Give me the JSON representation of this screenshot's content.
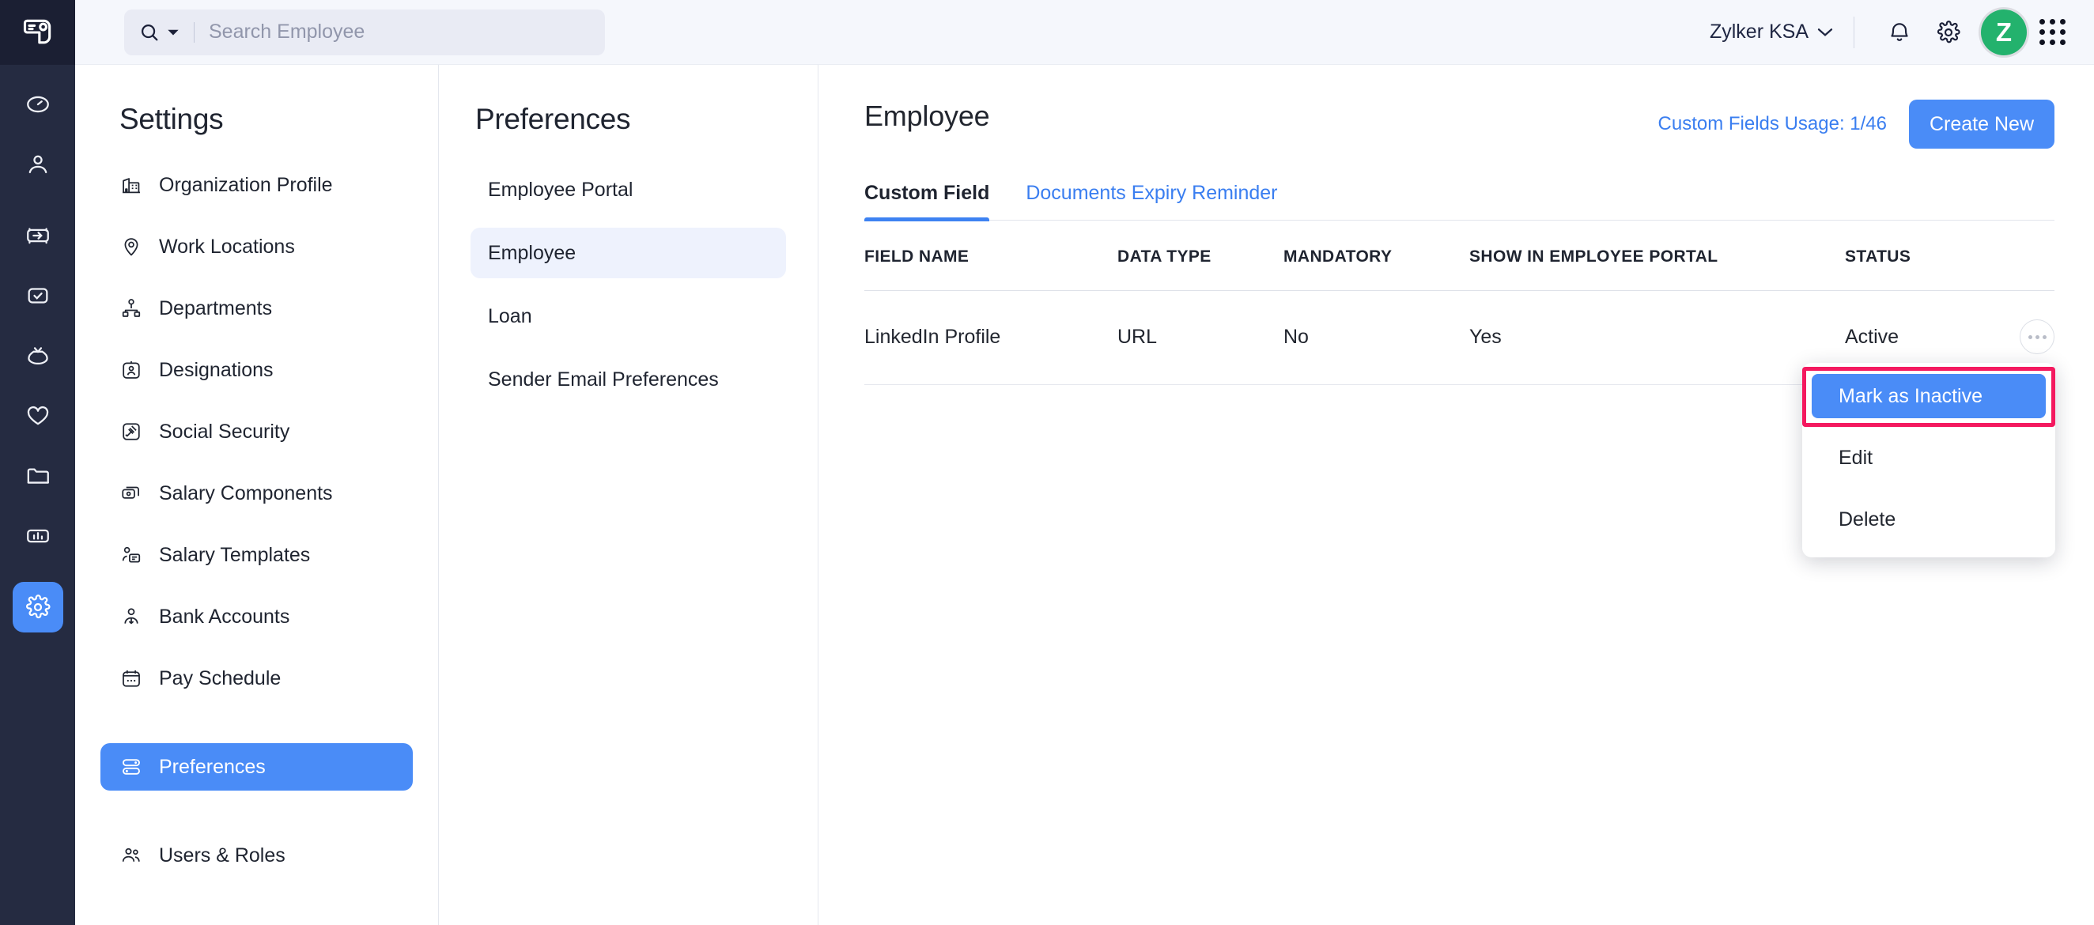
{
  "brand": {
    "logo_icon": "payroll-card-icon",
    "accent": "#4a8cf7",
    "avatar_bg": "#23b26d",
    "avatar_letter": "Z"
  },
  "rail": {
    "items": [
      {
        "name": "time-tracker-icon",
        "label": "Time Tracker",
        "active": false
      },
      {
        "name": "employees-icon",
        "label": "Employees",
        "active": false
      },
      {
        "name": "onboarding-icon",
        "label": "Onboarding",
        "active": false
      },
      {
        "name": "approvals-icon",
        "label": "Approvals",
        "active": false
      },
      {
        "name": "payroll-bag-icon",
        "label": "Pay Runs",
        "active": false
      },
      {
        "name": "benefits-heart-icon",
        "label": "Benefits",
        "active": false
      },
      {
        "name": "documents-folder-icon",
        "label": "Documents",
        "active": false
      },
      {
        "name": "reports-chart-icon",
        "label": "Reports",
        "active": false
      },
      {
        "name": "settings-gear-icon",
        "label": "Settings",
        "active": true
      }
    ]
  },
  "topbar": {
    "search": {
      "placeholder": "Search Employee",
      "value": "",
      "scope_icon": "search-icon",
      "caret_icon": "chevron-down-icon"
    },
    "org": {
      "name": "Zylker KSA",
      "caret_icon": "chevron-down-icon"
    },
    "icons": [
      {
        "name": "notifications-bell-icon",
        "label": "Notifications"
      },
      {
        "name": "settings-gear-icon",
        "label": "Settings"
      }
    ],
    "apps_icon": "apps-grid-icon"
  },
  "settings_panel": {
    "title": "Settings",
    "items": [
      {
        "label": "Organization Profile",
        "icon": "organization-building-icon",
        "active": false
      },
      {
        "label": "Work Locations",
        "icon": "location-pin-icon",
        "active": false
      },
      {
        "label": "Departments",
        "icon": "departments-hierarchy-icon",
        "active": false
      },
      {
        "label": "Designations",
        "icon": "designation-badge-icon",
        "active": false
      },
      {
        "label": "Social Security",
        "icon": "social-security-gavel-icon",
        "active": false
      },
      {
        "label": "Salary Components",
        "icon": "salary-components-cards-icon",
        "active": false
      },
      {
        "label": "Salary Templates",
        "icon": "salary-template-icon",
        "active": false
      },
      {
        "label": "Bank Accounts",
        "icon": "bank-account-person-icon",
        "active": false
      },
      {
        "label": "Pay Schedule",
        "icon": "calendar-icon",
        "active": false
      },
      {
        "label": "Preferences",
        "icon": "preferences-toggles-icon",
        "active": true
      },
      {
        "label": "Users & Roles",
        "icon": "users-roles-icon",
        "active": false
      }
    ]
  },
  "preferences_panel": {
    "title": "Preferences",
    "items": [
      {
        "label": "Employee Portal",
        "active": false
      },
      {
        "label": "Employee",
        "active": true
      },
      {
        "label": "Loan",
        "active": false
      },
      {
        "label": "Sender Email Preferences",
        "active": false
      }
    ]
  },
  "main": {
    "title": "Employee",
    "usage_label": "Custom Fields Usage: 1/46",
    "create_button": "Create New",
    "tabs": [
      {
        "label": "Custom Field",
        "active": true
      },
      {
        "label": "Documents Expiry Reminder",
        "active": false
      }
    ],
    "table": {
      "columns": [
        "FIELD NAME",
        "DATA TYPE",
        "MANDATORY",
        "SHOW IN EMPLOYEE PORTAL",
        "STATUS",
        ""
      ],
      "rows": [
        {
          "field_name": "LinkedIn Profile",
          "data_type": "URL",
          "mandatory": "No",
          "show_in_portal": "Yes",
          "status": "Active",
          "status_color": "#27ae3f",
          "actions_icon": "ellipsis-icon"
        }
      ]
    },
    "row_menu": {
      "items": [
        {
          "label": "Mark as Inactive",
          "highlighted": true
        },
        {
          "label": "Edit",
          "highlighted": false
        },
        {
          "label": "Delete",
          "highlighted": false
        }
      ],
      "focus_ring_color": "#f4195f"
    }
  }
}
